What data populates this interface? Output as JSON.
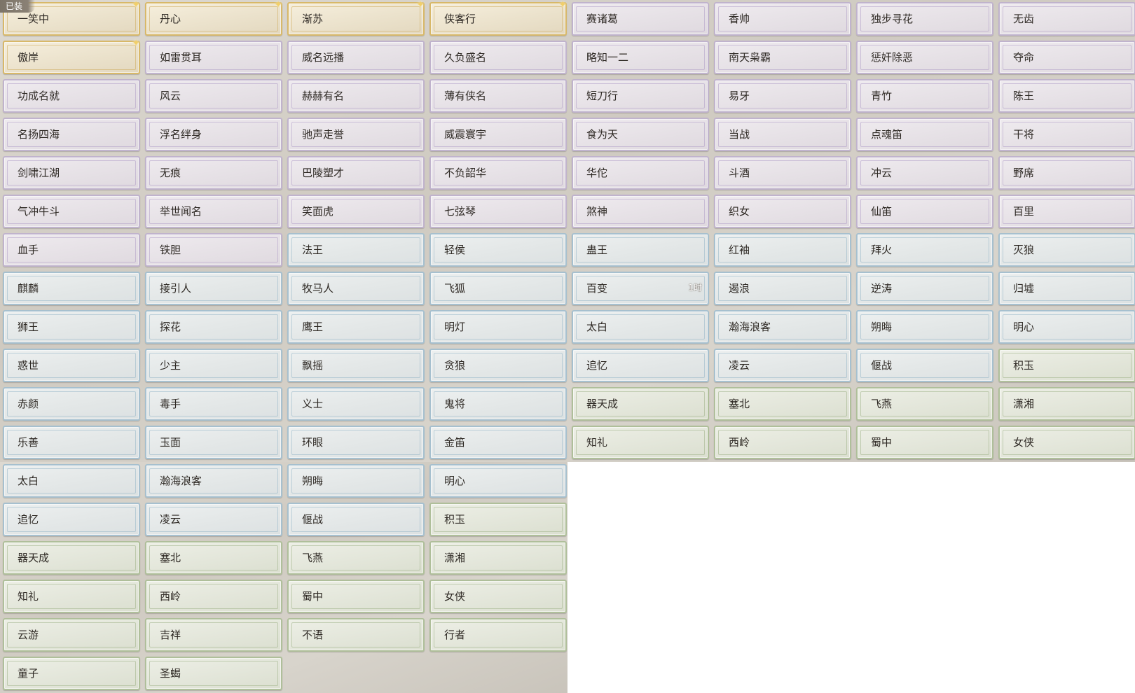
{
  "equipped_badge": "已装",
  "top_cards": [
    {
      "label": "一笑中",
      "tier": "gold",
      "equipped": true
    },
    {
      "label": "丹心",
      "tier": "gold"
    },
    {
      "label": "渐苏",
      "tier": "gold"
    },
    {
      "label": "侠客行",
      "tier": "gold"
    },
    {
      "label": "赛诸葛",
      "tier": "purple"
    },
    {
      "label": "香帅",
      "tier": "purple"
    },
    {
      "label": "独步寻花",
      "tier": "purple"
    },
    {
      "label": "无齿",
      "tier": "purple"
    },
    {
      "label": "傲岸",
      "tier": "gold"
    },
    {
      "label": "如雷贯耳",
      "tier": "purple"
    },
    {
      "label": "威名远播",
      "tier": "purple"
    },
    {
      "label": "久负盛名",
      "tier": "purple"
    },
    {
      "label": "略知一二",
      "tier": "purple"
    },
    {
      "label": "南天枭霸",
      "tier": "purple"
    },
    {
      "label": "惩奸除恶",
      "tier": "purple"
    },
    {
      "label": "夺命",
      "tier": "purple"
    },
    {
      "label": "功成名就",
      "tier": "purple"
    },
    {
      "label": "风云",
      "tier": "purple"
    },
    {
      "label": "赫赫有名",
      "tier": "purple"
    },
    {
      "label": "薄有侠名",
      "tier": "purple"
    },
    {
      "label": "短刀行",
      "tier": "purple"
    },
    {
      "label": "易牙",
      "tier": "purple"
    },
    {
      "label": "青竹",
      "tier": "purple"
    },
    {
      "label": "陈王",
      "tier": "purple"
    },
    {
      "label": "名扬四海",
      "tier": "purple"
    },
    {
      "label": "浮名绊身",
      "tier": "purple"
    },
    {
      "label": "驰声走誉",
      "tier": "purple"
    },
    {
      "label": "威震寰宇",
      "tier": "purple"
    },
    {
      "label": "食为天",
      "tier": "purple"
    },
    {
      "label": "当战",
      "tier": "purple"
    },
    {
      "label": "点魂笛",
      "tier": "purple"
    },
    {
      "label": "干将",
      "tier": "purple"
    },
    {
      "label": "剑啸江湖",
      "tier": "purple"
    },
    {
      "label": "无痕",
      "tier": "purple"
    },
    {
      "label": "巴陵塑才",
      "tier": "purple"
    },
    {
      "label": "不负韶华",
      "tier": "purple"
    },
    {
      "label": "华佗",
      "tier": "purple"
    },
    {
      "label": "斗酒",
      "tier": "purple"
    },
    {
      "label": "冲云",
      "tier": "purple"
    },
    {
      "label": "野席",
      "tier": "purple"
    },
    {
      "label": "气冲牛斗",
      "tier": "purple"
    },
    {
      "label": "举世闻名",
      "tier": "purple"
    },
    {
      "label": "笑面虎",
      "tier": "purple"
    },
    {
      "label": "七弦琴",
      "tier": "purple"
    },
    {
      "label": "煞神",
      "tier": "purple"
    },
    {
      "label": "织女",
      "tier": "purple"
    },
    {
      "label": "仙笛",
      "tier": "purple"
    },
    {
      "label": "百里",
      "tier": "purple"
    },
    {
      "label": "血手",
      "tier": "purple"
    },
    {
      "label": "铁胆",
      "tier": "purple"
    },
    {
      "label": "法王",
      "tier": "blue"
    },
    {
      "label": "轻侯",
      "tier": "blue"
    },
    {
      "label": "蛊王",
      "tier": "blue"
    },
    {
      "label": "红袖",
      "tier": "blue"
    },
    {
      "label": "拜火",
      "tier": "blue"
    },
    {
      "label": "灭狼",
      "tier": "blue"
    },
    {
      "label": "麒麟",
      "tier": "blue"
    },
    {
      "label": "接引人",
      "tier": "blue"
    },
    {
      "label": "牧马人",
      "tier": "blue"
    },
    {
      "label": "飞狐",
      "tier": "blue"
    },
    {
      "label": "百变",
      "tier": "blue",
      "timer": "1时"
    },
    {
      "label": "遏浪",
      "tier": "blue"
    },
    {
      "label": "逆涛",
      "tier": "blue"
    },
    {
      "label": "归墟",
      "tier": "blue"
    },
    {
      "label": "狮王",
      "tier": "blue"
    },
    {
      "label": "探花",
      "tier": "blue"
    },
    {
      "label": "鹰王",
      "tier": "blue"
    },
    {
      "label": "明灯",
      "tier": "blue"
    },
    {
      "label": "太白",
      "tier": "blue"
    },
    {
      "label": "瀚海浪客",
      "tier": "blue"
    },
    {
      "label": "朔晦",
      "tier": "blue"
    },
    {
      "label": "明心",
      "tier": "blue"
    },
    {
      "label": "惑世",
      "tier": "blue"
    },
    {
      "label": "少主",
      "tier": "blue"
    },
    {
      "label": "飘摇",
      "tier": "blue"
    },
    {
      "label": "贪狼",
      "tier": "blue"
    },
    {
      "label": "追忆",
      "tier": "blue"
    },
    {
      "label": "凌云",
      "tier": "blue"
    },
    {
      "label": "偃战",
      "tier": "blue"
    },
    {
      "label": "积玉",
      "tier": "green"
    },
    {
      "label": "赤颜",
      "tier": "blue"
    },
    {
      "label": "毒手",
      "tier": "blue"
    },
    {
      "label": "义士",
      "tier": "blue"
    },
    {
      "label": "鬼将",
      "tier": "blue"
    },
    {
      "label": "器天成",
      "tier": "green"
    },
    {
      "label": "塞北",
      "tier": "green"
    },
    {
      "label": "飞燕",
      "tier": "green"
    },
    {
      "label": "潇湘",
      "tier": "green"
    },
    {
      "label": "乐善",
      "tier": "blue"
    },
    {
      "label": "玉面",
      "tier": "blue"
    },
    {
      "label": "环眼",
      "tier": "blue"
    },
    {
      "label": "金笛",
      "tier": "blue"
    },
    {
      "label": "知礼",
      "tier": "green"
    },
    {
      "label": "西岭",
      "tier": "green"
    },
    {
      "label": "蜀中",
      "tier": "green"
    },
    {
      "label": "女侠",
      "tier": "green"
    }
  ],
  "bottom_cards": [
    {
      "label": "太白",
      "tier": "blue"
    },
    {
      "label": "瀚海浪客",
      "tier": "blue"
    },
    {
      "label": "朔晦",
      "tier": "blue"
    },
    {
      "label": "明心",
      "tier": "blue"
    },
    {
      "label": "追忆",
      "tier": "blue"
    },
    {
      "label": "凌云",
      "tier": "blue"
    },
    {
      "label": "偃战",
      "tier": "blue"
    },
    {
      "label": "积玉",
      "tier": "green"
    },
    {
      "label": "器天成",
      "tier": "green"
    },
    {
      "label": "塞北",
      "tier": "green"
    },
    {
      "label": "飞燕",
      "tier": "green"
    },
    {
      "label": "潇湘",
      "tier": "green"
    },
    {
      "label": "知礼",
      "tier": "green"
    },
    {
      "label": "西岭",
      "tier": "green"
    },
    {
      "label": "蜀中",
      "tier": "green"
    },
    {
      "label": "女侠",
      "tier": "green"
    },
    {
      "label": "云游",
      "tier": "green"
    },
    {
      "label": "吉祥",
      "tier": "green"
    },
    {
      "label": "不语",
      "tier": "green"
    },
    {
      "label": "行者",
      "tier": "green"
    },
    {
      "label": "童子",
      "tier": "green"
    },
    {
      "label": "圣蝎",
      "tier": "green"
    }
  ]
}
